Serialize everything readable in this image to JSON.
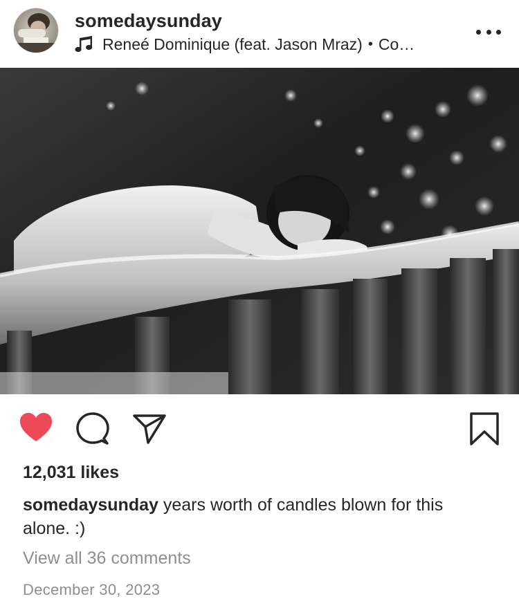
{
  "header": {
    "username": "somedaysunday",
    "audio": {
      "icon": "music-note-icon",
      "track": "Reneé Dominique (feat. Jason Mraz)",
      "separator": "•",
      "overflow": "Co…"
    },
    "more_icon": "more-options-icon"
  },
  "post_image": {
    "style": "black-and-white photo"
  },
  "actions": {
    "like_icon": "heart-icon",
    "liked": true,
    "like_color": "#ed4956",
    "comment_icon": "comment-icon",
    "share_icon": "send-icon",
    "save_icon": "bookmark-icon"
  },
  "likes": {
    "text": "12,031 likes"
  },
  "caption": {
    "username": "somedaysunday",
    "text": "years worth of candles blown for this alone. :)"
  },
  "comments": {
    "view_all": "View all 36 comments"
  },
  "date": "December 30, 2023",
  "colors": {
    "text": "#262626",
    "muted": "#8e8e8e",
    "background": "#ffffff"
  }
}
